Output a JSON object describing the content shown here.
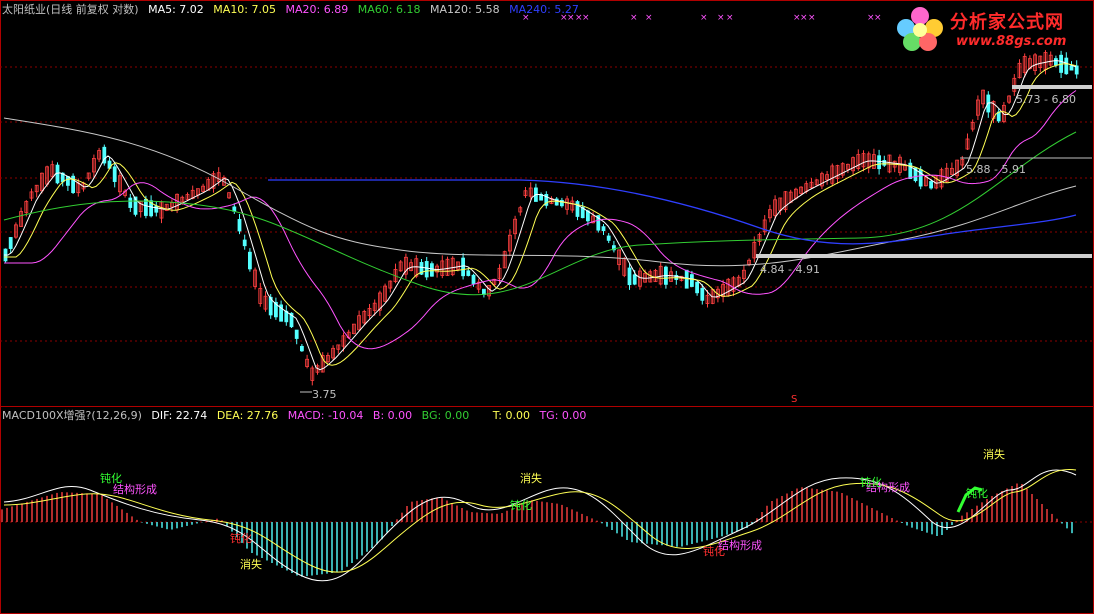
{
  "main_header": {
    "title": "太阳纸业(日线 前复权 对数)",
    "ma5": "MA5: 7.02",
    "ma10": "MA10: 7.05",
    "ma20": "MA20: 6.89",
    "ma60": "MA60: 6.18",
    "ma120": "MA120: 5.58",
    "ma240": "MA240: 5.27"
  },
  "sub_header": {
    "title": "MACD100X增强?(12,26,9)",
    "dif": "DIF: 22.74",
    "dea": "DEA: 27.76",
    "macd": "MACD: -10.04",
    "b": "B: 0.00",
    "bg": "BG: 0.00",
    "t": "T: 0.00",
    "tg": "TG: 0.00"
  },
  "price_labels": {
    "low": "3.75",
    "range1": "5.73 - 6.80",
    "range2": "5.88 - 5.91",
    "range3": "4.84 - 4.91",
    "marker": "S"
  },
  "macd_labels": {
    "l1": "钝化",
    "l2": "结构形成",
    "l3": "消失",
    "l4": "钝化",
    "l5": "消失",
    "l6": "钝化",
    "l7": "钝化",
    "l8": "结构形成",
    "l9": "结构形成",
    "l10": "消失",
    "l11": "钝化",
    "l12": "钝化",
    "l13": "消失"
  },
  "logo": {
    "title": "分析家公式网",
    "url": "www.88gs.com"
  },
  "colors": {
    "up": "#ff4040",
    "down": "#54ffff",
    "ma5": "#ffffff",
    "ma10": "#ffff54",
    "ma20": "#ff54ff",
    "ma60": "#32cd32",
    "ma120": "#c8c8c8",
    "ma240": "#2f3fff",
    "grid": "#8b0000",
    "frame": "#b00000"
  }
}
